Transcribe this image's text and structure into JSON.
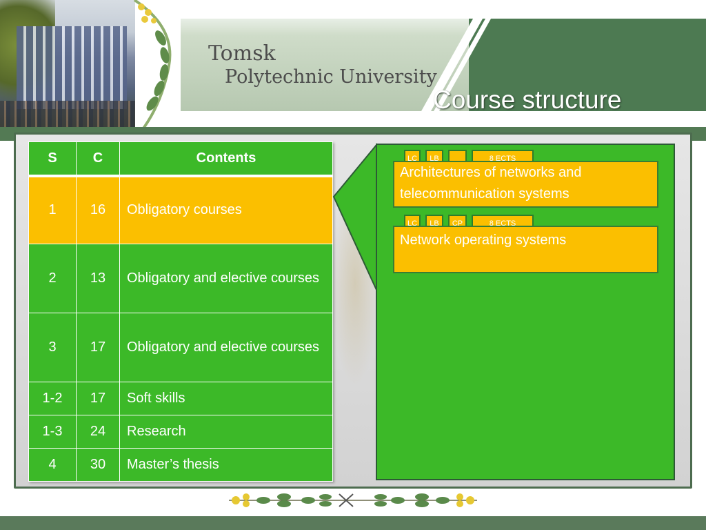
{
  "header": {
    "logo_line1": "Tomsk",
    "logo_line2": "Polytechnic University",
    "slide_title": "Course structure"
  },
  "table": {
    "headers": [
      "S",
      "C",
      "Contents"
    ],
    "rows": [
      {
        "s": "1",
        "c": "16",
        "contents": "Obligatory courses",
        "highlight": "yellow"
      },
      {
        "s": "2",
        "c": "13",
        "contents": "Obligatory and elective courses",
        "highlight": "green"
      },
      {
        "s": "3",
        "c": "17",
        "contents": "Obligatory and elective courses",
        "highlight": "green"
      },
      {
        "s": "1-2",
        "c": "17",
        "contents": "Soft skills",
        "highlight": "green"
      },
      {
        "s": "1-3",
        "c": "24",
        "contents": "Research",
        "highlight": "green"
      },
      {
        "s": "4",
        "c": "30",
        "contents": "Master’s thesis",
        "highlight": "green"
      }
    ]
  },
  "courses": [
    {
      "tags": [
        "LC",
        "LB",
        "",
        "8 ECTS"
      ],
      "name": "Architectures of networks and telecommunication systems"
    },
    {
      "tags": [
        "LC",
        "LB",
        "CP",
        "8 ECTS"
      ],
      "name": "Network operating systems"
    }
  ],
  "colors": {
    "green": "#3cb928",
    "yellow": "#fbbf00",
    "header_green": "#537a54"
  }
}
